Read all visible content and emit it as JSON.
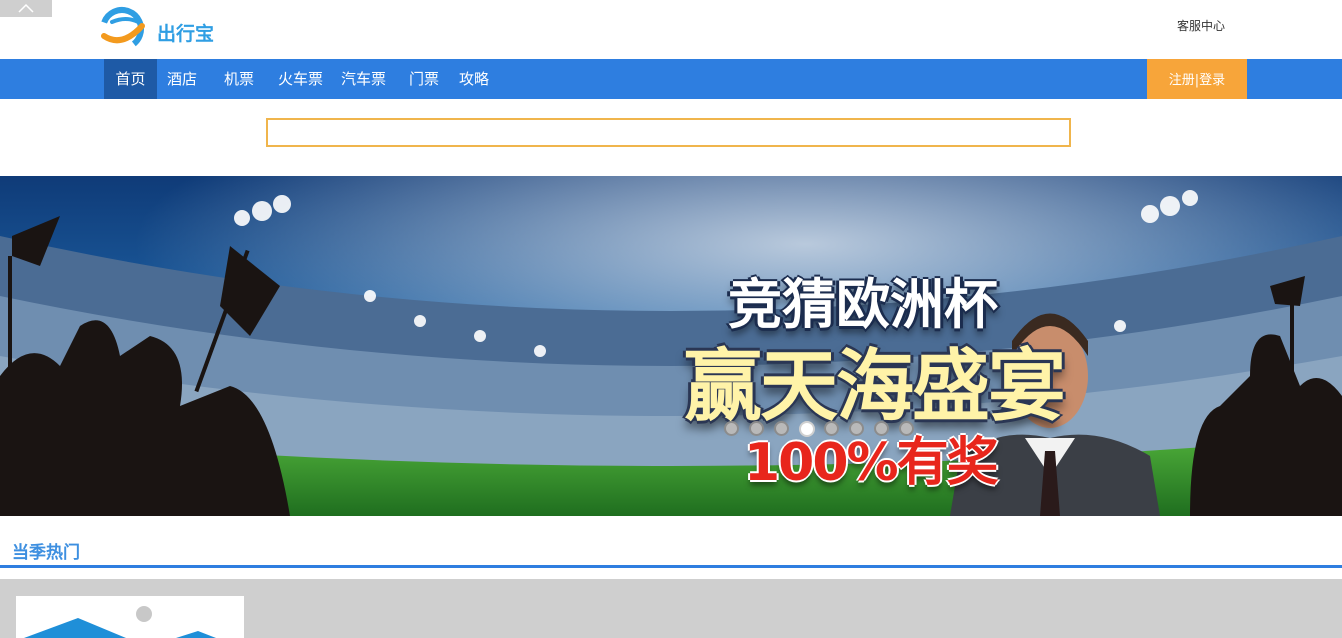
{
  "header": {
    "brand": "出行宝",
    "service_link": "客服中心"
  },
  "nav": {
    "items": [
      "首页",
      "酒店",
      "机票",
      "火车票",
      "汽车票",
      "门票",
      "攻略"
    ],
    "active_index": 0,
    "login_label": "注册|登录"
  },
  "search": {
    "value": "",
    "placeholder": ""
  },
  "banner": {
    "line1": "竞猜欧洲杯",
    "line2": "赢天海盛宴",
    "line3": "100%有奖",
    "slide_count": 8,
    "active_slide": 3
  },
  "section": {
    "title": "当季热门"
  },
  "colors": {
    "nav_bg": "#2e7ee0",
    "nav_active": "#1e5aa6",
    "login_bg": "#f7a53a",
    "search_border": "#f0b54c",
    "section_title": "#3d8fe0"
  },
  "icons": {
    "back_to_top": "chevron-up-icon",
    "logo": "logo-icon"
  }
}
